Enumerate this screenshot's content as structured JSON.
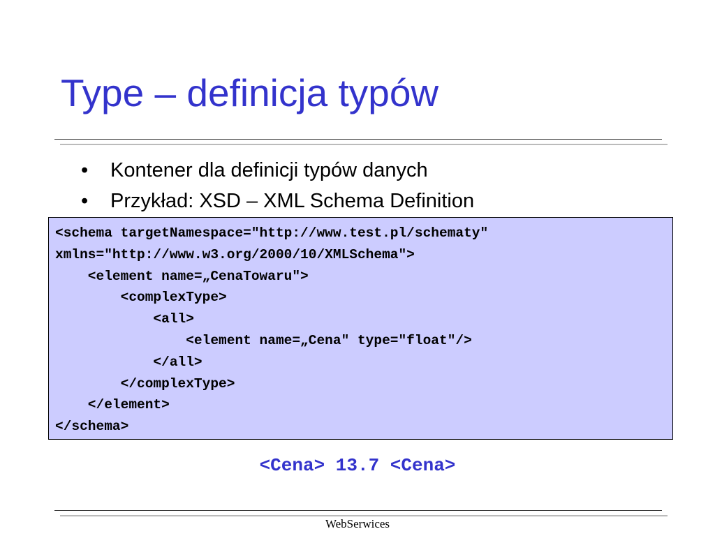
{
  "slide": {
    "title": "Type – definicja typów",
    "bullet_marker": "•",
    "bullets": [
      "Kontener dla definicji typów danych",
      "Przykład: XSD – XML Schema Definition"
    ],
    "code_lines": [
      "<schema targetNamespace=\"http://www.test.pl/schematy\"",
      "xmlns=\"http://www.w3.org/2000/10/XMLSchema\">",
      "    <element name=„CenaTowaru\">",
      "        <complexType>",
      "            <all>",
      "                <element name=„Cena\" type=\"float\"/>",
      "            </all>",
      "        </complexType>",
      "    </element>",
      "</schema>"
    ],
    "result_example": "<Cena> 13.7 <Cena>",
    "footer": "WebSerwices"
  },
  "colors": {
    "title": "#3333cc",
    "code_background": "#ccccff",
    "result_text": "#3333cc",
    "rule_dark": "#333333",
    "rule_light": "#bbbbbb"
  }
}
